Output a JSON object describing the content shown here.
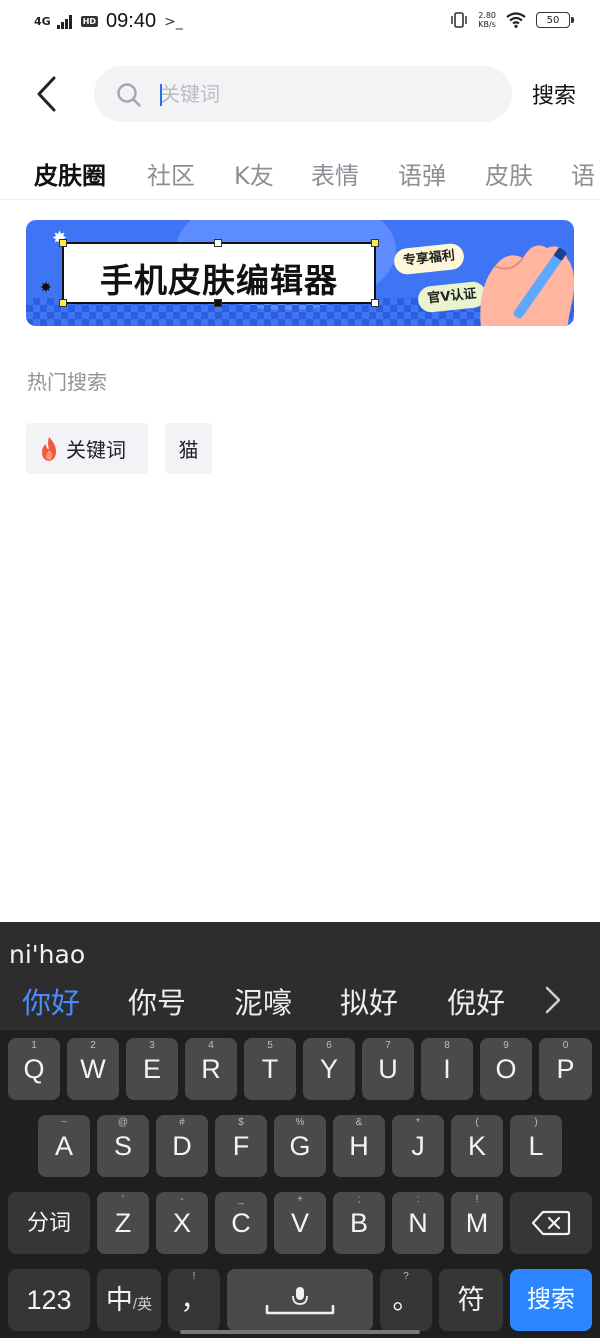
{
  "status_bar": {
    "network": "4G",
    "hd": "HD",
    "time": "09:40",
    "terminal": ">_",
    "speed_value": "2.80",
    "speed_unit": "KB/s",
    "battery": "50"
  },
  "header": {
    "search_placeholder": "关键词",
    "search_button": "搜索"
  },
  "tabs": [
    {
      "label": "皮肤圈",
      "active": true
    },
    {
      "label": "社区",
      "active": false
    },
    {
      "label": "K友",
      "active": false
    },
    {
      "label": "表情",
      "active": false
    },
    {
      "label": "语弹",
      "active": false
    },
    {
      "label": "皮肤",
      "active": false
    },
    {
      "label": "语",
      "active": false
    }
  ],
  "banner": {
    "title": "手机皮肤编辑器",
    "tag1": "专享福利",
    "tag2": "官V认证"
  },
  "hot_search": {
    "title": "热门搜索",
    "items": [
      "关键词",
      "猫"
    ]
  },
  "keyboard": {
    "pinyin": "ni'hao",
    "candidates": [
      "你好",
      "你号",
      "泥嚎",
      "拟好",
      "倪好"
    ],
    "row1": [
      {
        "key": "Q",
        "hint": "1"
      },
      {
        "key": "W",
        "hint": "2"
      },
      {
        "key": "E",
        "hint": "3"
      },
      {
        "key": "R",
        "hint": "4"
      },
      {
        "key": "T",
        "hint": "5"
      },
      {
        "key": "Y",
        "hint": "6"
      },
      {
        "key": "U",
        "hint": "7"
      },
      {
        "key": "I",
        "hint": "8"
      },
      {
        "key": "O",
        "hint": "9"
      },
      {
        "key": "P",
        "hint": "0"
      }
    ],
    "row2": [
      {
        "key": "A",
        "hint": "~"
      },
      {
        "key": "S",
        "hint": "@"
      },
      {
        "key": "D",
        "hint": "#"
      },
      {
        "key": "F",
        "hint": "$"
      },
      {
        "key": "G",
        "hint": "%"
      },
      {
        "key": "H",
        "hint": "&"
      },
      {
        "key": "J",
        "hint": "*"
      },
      {
        "key": "K",
        "hint": "("
      },
      {
        "key": "L",
        "hint": ")"
      }
    ],
    "row3": [
      {
        "key": "Z",
        "hint": "'"
      },
      {
        "key": "X",
        "hint": "-"
      },
      {
        "key": "C",
        "hint": "_"
      },
      {
        "key": "V",
        "hint": "+"
      },
      {
        "key": "B",
        "hint": ";"
      },
      {
        "key": "N",
        "hint": ":"
      },
      {
        "key": "M",
        "hint": "!"
      }
    ],
    "segment_key": "分词",
    "num_key": "123",
    "lang_key_main": "中",
    "lang_key_sub": "/英",
    "comma_key": "，",
    "comma_hint": "!",
    "period_key": "。",
    "period_hint": "?",
    "symbol_key": "符",
    "enter_key": "搜索"
  }
}
